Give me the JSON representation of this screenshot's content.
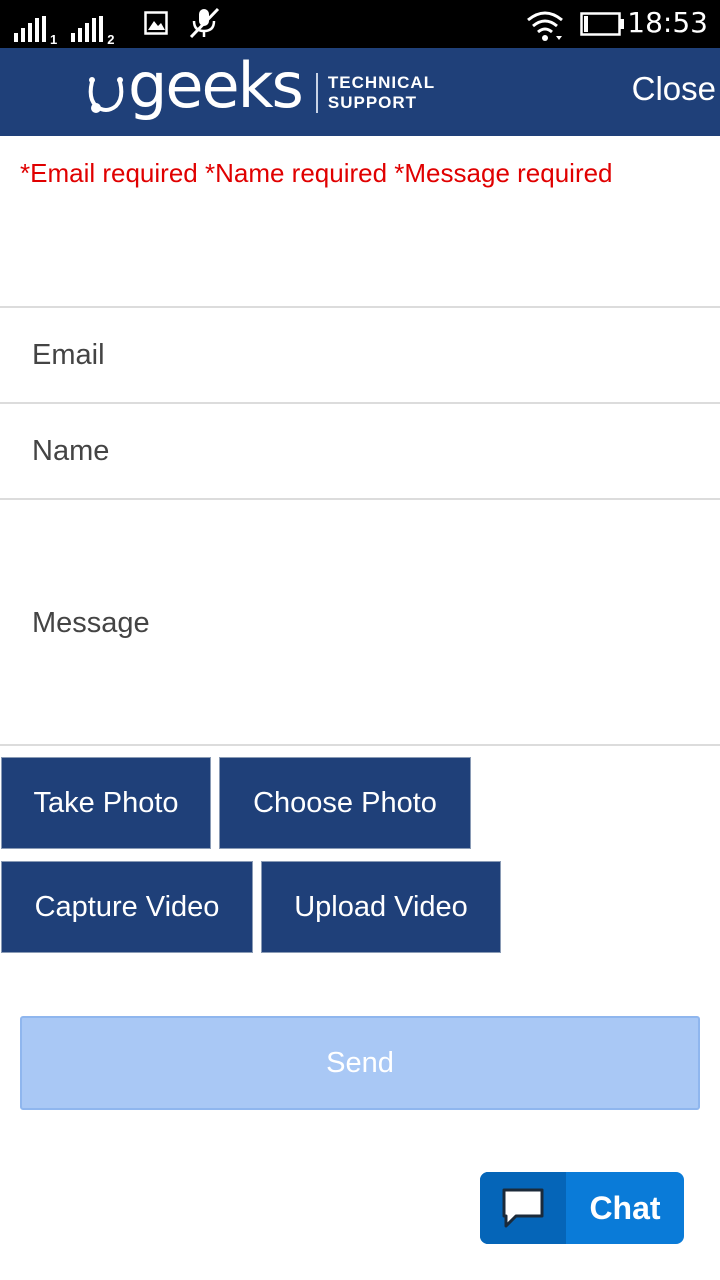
{
  "status_bar": {
    "sim1_label": "1",
    "sim2_label": "2",
    "time": "18:53",
    "icons": [
      "signal-sim1-icon",
      "signal-sim2-icon",
      "gallery-icon",
      "mute-mic-icon",
      "wifi-icon",
      "battery-icon"
    ]
  },
  "header": {
    "logo_word": "geeks",
    "logo_sub_line1": "TECHNICAL",
    "logo_sub_line2": "SUPPORT",
    "close_label": "Close",
    "background": "#1f4079"
  },
  "form": {
    "errors_text": "*Email required *Name required *Message required",
    "error_color": "#e00000",
    "email_placeholder": "Email",
    "name_placeholder": "Name",
    "message_placeholder": "Message"
  },
  "media_buttons": {
    "take_photo": "Take Photo",
    "choose_photo": "Choose Photo",
    "capture_video": "Capture Video",
    "upload_video": "Upload Video"
  },
  "send": {
    "label": "Send",
    "state": "disabled",
    "background": "#a9c8f5"
  },
  "chat": {
    "label": "Chat",
    "icon": "speech-bubble-icon",
    "background": "#0a7bd8"
  }
}
